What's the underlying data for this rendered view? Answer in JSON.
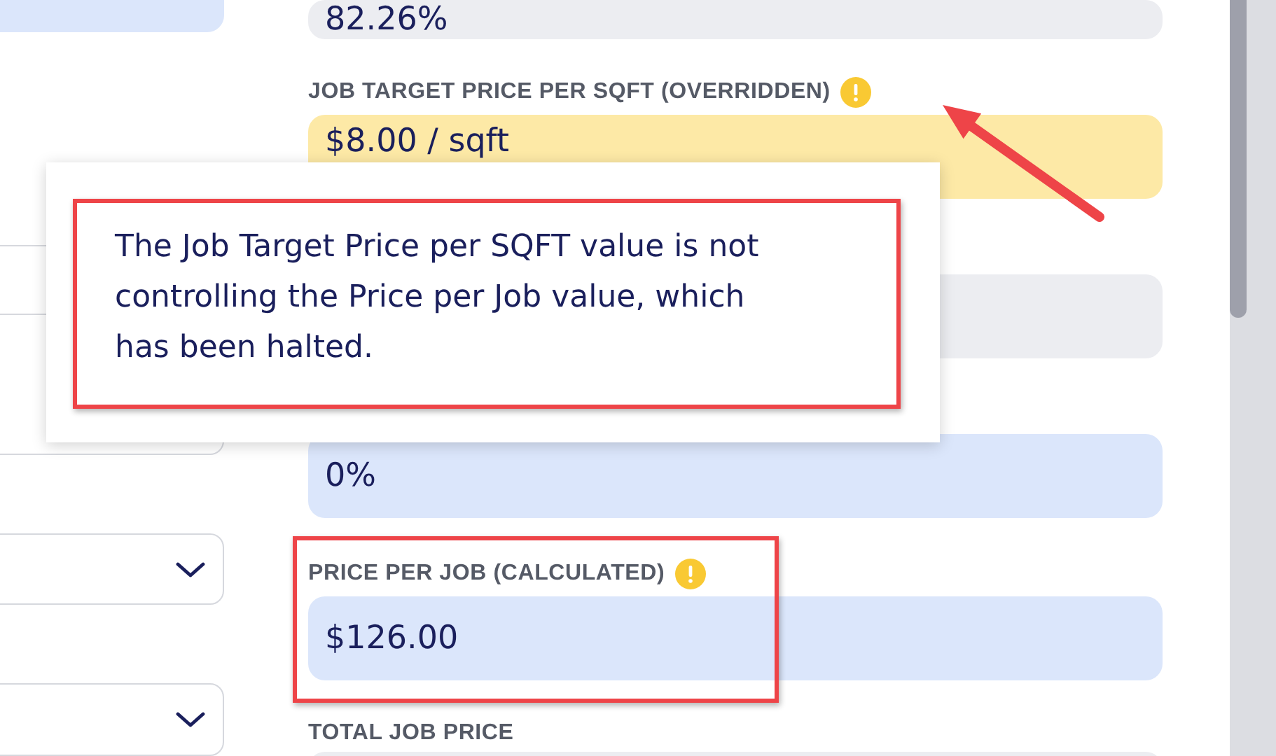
{
  "left_controls": [
    {
      "kind": "filled"
    },
    {
      "kind": "stepper-top"
    },
    {
      "kind": "input"
    },
    {
      "kind": "input"
    },
    {
      "kind": "stepper"
    },
    {
      "kind": "dropdown"
    },
    {
      "kind": "dropdown"
    }
  ],
  "fields": [
    {
      "value": "82.26%",
      "kind": "readonly",
      "warning": false,
      "highlighted": false
    },
    {
      "label": "JOB TARGET PRICE PER SQFT (OVERRIDDEN)",
      "value": "$8.00 / sqft",
      "kind": "overridden",
      "warning": true,
      "highlighted": false
    },
    {
      "kind": "readonly",
      "warning": false,
      "highlighted": false
    },
    {
      "value": "0%",
      "kind": "editable",
      "warning": false,
      "highlighted": false
    },
    {
      "label": "PRICE PER JOB (CALCULATED)",
      "value": "$126.00",
      "kind": "editable",
      "warning": true,
      "highlighted": true
    },
    {
      "label": "TOTAL JOB PRICE",
      "kind": "readonly",
      "warning": false,
      "highlighted": false
    }
  ],
  "tooltip": {
    "text": "The Job Target Price per SQFT value is not controlling the Price per Job value, which has been halted.",
    "highlighted": true
  }
}
